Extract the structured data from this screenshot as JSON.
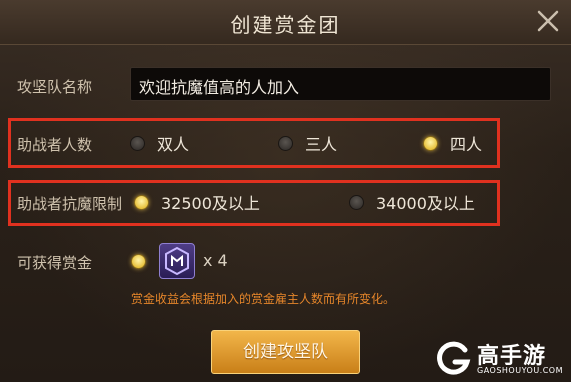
{
  "dialog": {
    "title": "创建赏金团",
    "close_icon": "close-icon"
  },
  "team_name": {
    "label": "攻坚队名称",
    "value": "欢迎抗魔值高的人加入"
  },
  "helper_count": {
    "label": "助战者人数",
    "options": [
      {
        "label": "双人",
        "selected": false
      },
      {
        "label": "三人",
        "selected": false
      },
      {
        "label": "四人",
        "selected": true
      }
    ]
  },
  "resist_limit": {
    "label": "助战者抗魔限制",
    "options": [
      {
        "label": "32500及以上",
        "selected": true
      },
      {
        "label": "34000及以上",
        "selected": false
      }
    ]
  },
  "reward": {
    "label": "可获得赏金",
    "selected": true,
    "item_icon": "bounty-item-icon",
    "quantity": "x 4",
    "note": "赏金收益会根据加入的赏金雇主人数而有所变化。"
  },
  "create_button": "创建攻坚队",
  "watermark": {
    "text": "高手游",
    "sub": "GAOSHOUYOU.COM"
  },
  "colors": {
    "highlight_box": "#e0311f",
    "radio_on": "#e8c23e",
    "note": "#e6862a",
    "button": "#f2b64a"
  }
}
